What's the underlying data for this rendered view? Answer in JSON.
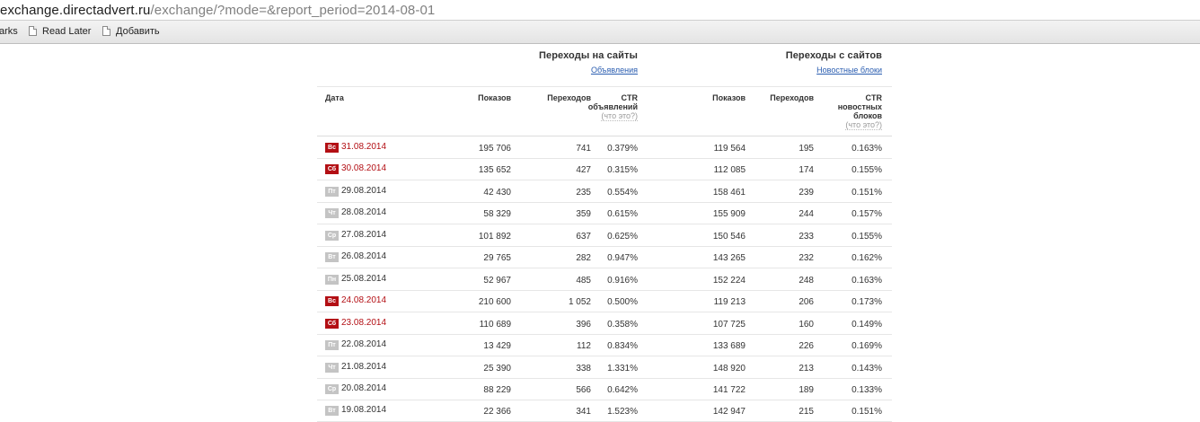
{
  "browser": {
    "address_main": "exchange.directadvert.ru",
    "address_rest": "/exchange/?mode=&report_period=2014-08-01",
    "bookmarks": [
      "arks",
      "Read Later",
      "Добавить"
    ]
  },
  "groups": [
    {
      "title": "Переходы на сайты",
      "link": "Объявления"
    },
    {
      "title": "Переходы с сайтов",
      "link": "Новостные блоки"
    }
  ],
  "columns": {
    "date": "Дата",
    "shows1": "Показов",
    "clicks1": "Переходов",
    "ctr1": [
      "CTR",
      "объявлений"
    ],
    "shows2": "Показов",
    "clicks2": "Переходов",
    "ctr2": [
      "CTR",
      "новостных",
      "блоков"
    ],
    "what": "(что это?)"
  },
  "colors": {
    "weekend": "#b30f14",
    "weekday_badge": "#c4c4c4",
    "link": "#2a5db0"
  },
  "rows": [
    {
      "dow": "Вс",
      "weekend": true,
      "date": "31.08.2014",
      "s1": "195 706",
      "c1": "741",
      "ctr1": "0.379%",
      "s2": "119 564",
      "c2": "195",
      "ctr2": "0.163%"
    },
    {
      "dow": "Сб",
      "weekend": true,
      "date": "30.08.2014",
      "s1": "135 652",
      "c1": "427",
      "ctr1": "0.315%",
      "s2": "112 085",
      "c2": "174",
      "ctr2": "0.155%"
    },
    {
      "dow": "Пт",
      "weekend": false,
      "date": "29.08.2014",
      "s1": "42 430",
      "c1": "235",
      "ctr1": "0.554%",
      "s2": "158 461",
      "c2": "239",
      "ctr2": "0.151%"
    },
    {
      "dow": "Чт",
      "weekend": false,
      "date": "28.08.2014",
      "s1": "58 329",
      "c1": "359",
      "ctr1": "0.615%",
      "s2": "155 909",
      "c2": "244",
      "ctr2": "0.157%"
    },
    {
      "dow": "Ср",
      "weekend": false,
      "date": "27.08.2014",
      "s1": "101 892",
      "c1": "637",
      "ctr1": "0.625%",
      "s2": "150 546",
      "c2": "233",
      "ctr2": "0.155%"
    },
    {
      "dow": "Вт",
      "weekend": false,
      "date": "26.08.2014",
      "s1": "29 765",
      "c1": "282",
      "ctr1": "0.947%",
      "s2": "143 265",
      "c2": "232",
      "ctr2": "0.162%"
    },
    {
      "dow": "Пн",
      "weekend": false,
      "date": "25.08.2014",
      "s1": "52 967",
      "c1": "485",
      "ctr1": "0.916%",
      "s2": "152 224",
      "c2": "248",
      "ctr2": "0.163%"
    },
    {
      "dow": "Вс",
      "weekend": true,
      "date": "24.08.2014",
      "s1": "210 600",
      "c1": "1 052",
      "ctr1": "0.500%",
      "s2": "119 213",
      "c2": "206",
      "ctr2": "0.173%"
    },
    {
      "dow": "Сб",
      "weekend": true,
      "date": "23.08.2014",
      "s1": "110 689",
      "c1": "396",
      "ctr1": "0.358%",
      "s2": "107 725",
      "c2": "160",
      "ctr2": "0.149%"
    },
    {
      "dow": "Пт",
      "weekend": false,
      "date": "22.08.2014",
      "s1": "13 429",
      "c1": "112",
      "ctr1": "0.834%",
      "s2": "133 689",
      "c2": "226",
      "ctr2": "0.169%"
    },
    {
      "dow": "Чт",
      "weekend": false,
      "date": "21.08.2014",
      "s1": "25 390",
      "c1": "338",
      "ctr1": "1.331%",
      "s2": "148 920",
      "c2": "213",
      "ctr2": "0.143%"
    },
    {
      "dow": "Ср",
      "weekend": false,
      "date": "20.08.2014",
      "s1": "88 229",
      "c1": "566",
      "ctr1": "0.642%",
      "s2": "141 722",
      "c2": "189",
      "ctr2": "0.133%"
    },
    {
      "dow": "Вт",
      "weekend": false,
      "date": "19.08.2014",
      "s1": "22 366",
      "c1": "341",
      "ctr1": "1.523%",
      "s2": "142 947",
      "c2": "215",
      "ctr2": "0.151%"
    }
  ]
}
